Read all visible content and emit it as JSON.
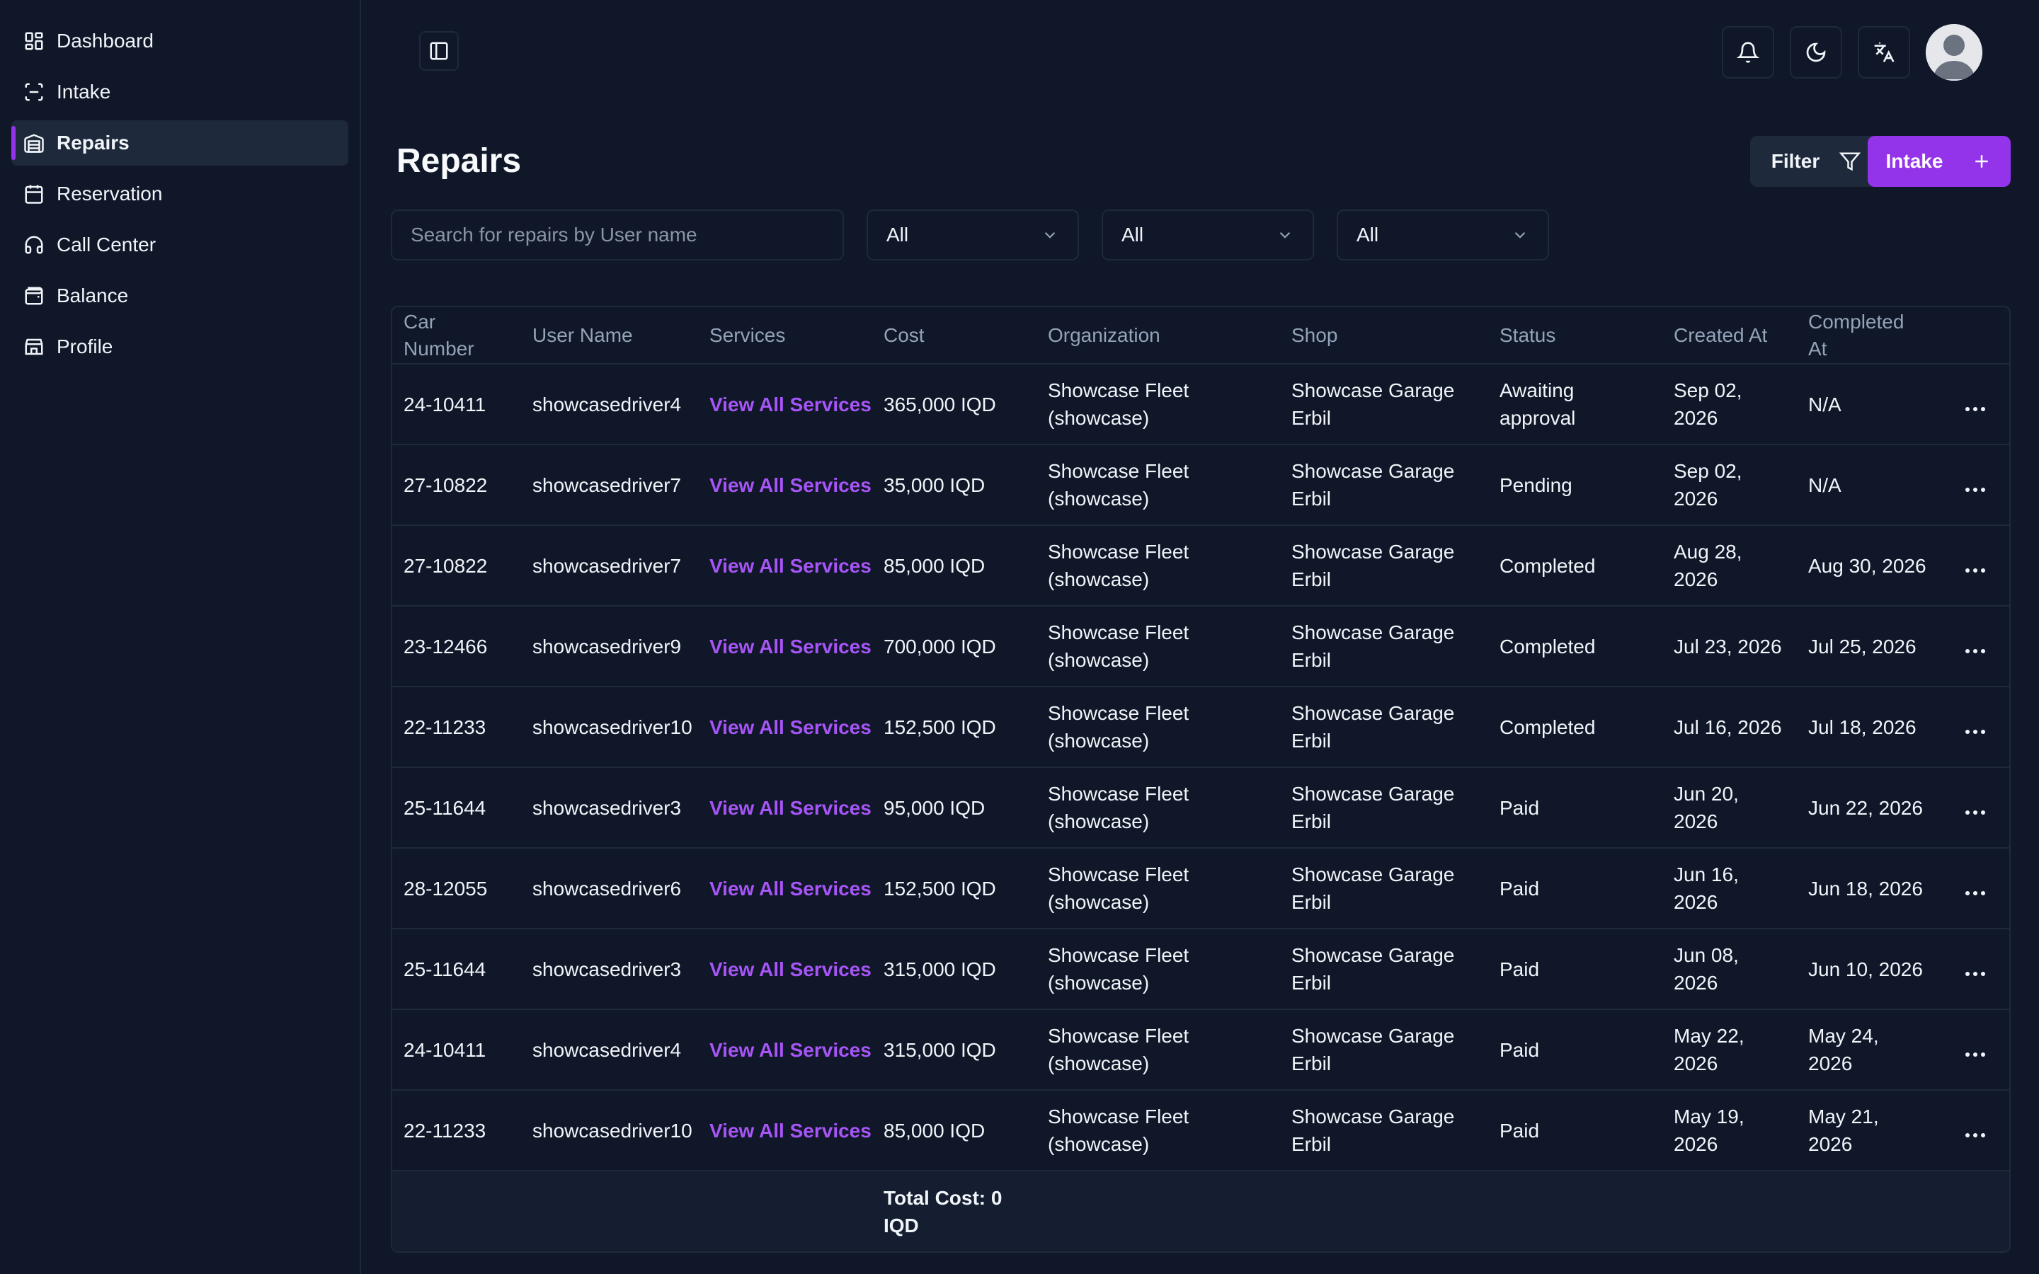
{
  "sidebar": {
    "items": [
      {
        "label": "Dashboard",
        "icon": "dashboard-icon"
      },
      {
        "label": "Intake",
        "icon": "scan-icon"
      },
      {
        "label": "Repairs",
        "icon": "warehouse-icon",
        "active": true
      },
      {
        "label": "Reservation",
        "icon": "calendar-icon"
      },
      {
        "label": "Call Center",
        "icon": "headset-icon"
      },
      {
        "label": "Balance",
        "icon": "wallet-icon"
      },
      {
        "label": "Profile",
        "icon": "store-icon"
      }
    ]
  },
  "header": {
    "title": "Repairs",
    "filter_label": "Filter",
    "intake_label": "Intake"
  },
  "filters": {
    "search_placeholder": "Search for repairs by User name",
    "select1": "All",
    "select2": "All",
    "select3": "All"
  },
  "table": {
    "headers": [
      "Car Number",
      "User Name",
      "Services",
      "Cost",
      "Organization",
      "Shop",
      "Status",
      "Created At",
      "Completed At"
    ],
    "rows": [
      {
        "car": "24-10411",
        "user": "showcasedriver4",
        "services": "View All Services",
        "cost": "365,000 IQD",
        "org": "Showcase Fleet (showcase)",
        "shop": "Showcase Garage Erbil",
        "status": "Awaiting approval",
        "created": "Sep 02, 2026",
        "completed": "N/A"
      },
      {
        "car": "27-10822",
        "user": "showcasedriver7",
        "services": "View All Services",
        "cost": "35,000 IQD",
        "org": "Showcase Fleet (showcase)",
        "shop": "Showcase Garage Erbil",
        "status": "Pending",
        "created": "Sep 02, 2026",
        "completed": "N/A"
      },
      {
        "car": "27-10822",
        "user": "showcasedriver7",
        "services": "View All Services",
        "cost": "85,000 IQD",
        "org": "Showcase Fleet (showcase)",
        "shop": "Showcase Garage Erbil",
        "status": "Completed",
        "created": "Aug 28, 2026",
        "completed": "Aug 30, 2026"
      },
      {
        "car": "23-12466",
        "user": "showcasedriver9",
        "services": "View All Services",
        "cost": "700,000 IQD",
        "org": "Showcase Fleet (showcase)",
        "shop": "Showcase Garage Erbil",
        "status": "Completed",
        "created": "Jul 23, 2026",
        "completed": "Jul 25, 2026"
      },
      {
        "car": "22-11233",
        "user": "showcasedriver10",
        "services": "View All Services",
        "cost": "152,500 IQD",
        "org": "Showcase Fleet (showcase)",
        "shop": "Showcase Garage Erbil",
        "status": "Completed",
        "created": "Jul 16, 2026",
        "completed": "Jul 18, 2026"
      },
      {
        "car": "25-11644",
        "user": "showcasedriver3",
        "services": "View All Services",
        "cost": "95,000 IQD",
        "org": "Showcase Fleet (showcase)",
        "shop": "Showcase Garage Erbil",
        "status": "Paid",
        "created": "Jun 20, 2026",
        "completed": "Jun 22, 2026"
      },
      {
        "car": "28-12055",
        "user": "showcasedriver6",
        "services": "View All Services",
        "cost": "152,500 IQD",
        "org": "Showcase Fleet (showcase)",
        "shop": "Showcase Garage Erbil",
        "status": "Paid",
        "created": "Jun 16, 2026",
        "completed": "Jun 18, 2026"
      },
      {
        "car": "25-11644",
        "user": "showcasedriver3",
        "services": "View All Services",
        "cost": "315,000 IQD",
        "org": "Showcase Fleet (showcase)",
        "shop": "Showcase Garage Erbil",
        "status": "Paid",
        "created": "Jun 08, 2026",
        "completed": "Jun 10, 2026"
      },
      {
        "car": "24-10411",
        "user": "showcasedriver4",
        "services": "View All Services",
        "cost": "315,000 IQD",
        "org": "Showcase Fleet (showcase)",
        "shop": "Showcase Garage Erbil",
        "status": "Paid",
        "created": "May 22, 2026",
        "completed": "May 24, 2026"
      },
      {
        "car": "22-11233",
        "user": "showcasedriver10",
        "services": "View All Services",
        "cost": "85,000 IQD",
        "org": "Showcase Fleet (showcase)",
        "shop": "Showcase Garage Erbil",
        "status": "Paid",
        "created": "May 19, 2026",
        "completed": "May 21, 2026"
      }
    ],
    "total_cost": "Total Cost: 0 IQD"
  },
  "colors": {
    "background": "#0f1729",
    "accent": "#9333ea",
    "link": "#a855f7",
    "border": "#1e293b"
  }
}
